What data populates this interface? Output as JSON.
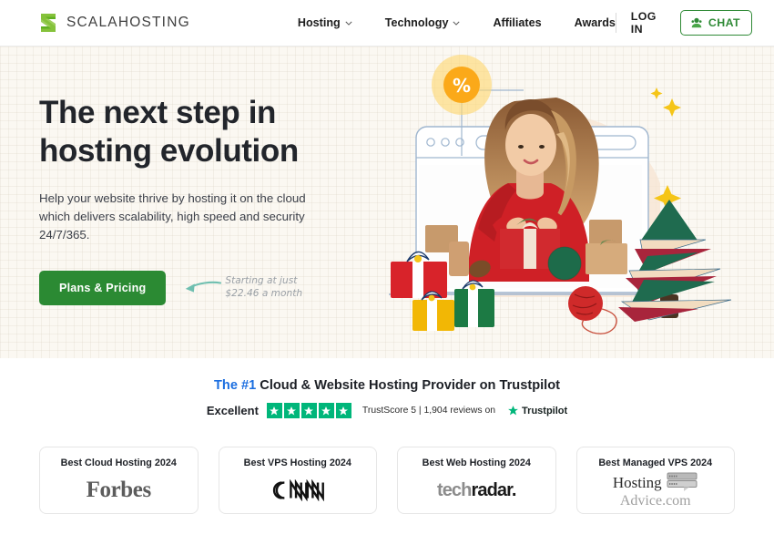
{
  "header": {
    "logo": {
      "icon": "scalahosting-s-logo-icon",
      "text": "SCALAHOSTING"
    },
    "nav": [
      {
        "label": "Hosting",
        "has_dropdown": true,
        "icon": "chevron-down-icon"
      },
      {
        "label": "Technology",
        "has_dropdown": true,
        "icon": "chevron-down-icon"
      },
      {
        "label": "Affiliates",
        "has_dropdown": false
      },
      {
        "label": "Awards",
        "has_dropdown": false
      }
    ],
    "login_label": "LOG IN",
    "chat_label": "CHAT",
    "chat_icon": "support-agent-icon"
  },
  "hero": {
    "heading": "The next step in hosting evolution",
    "subheading": "Help your website thrive by hosting it on the cloud which delivers scalability, high speed and security 24/7/365.",
    "cta_label": "Plans & Pricing",
    "note": "Starting at just\n$22.46 a month",
    "arrow_icon": "curved-left-arrow-icon",
    "illustration": {
      "name": "christmas-gift-wrapping-illustration",
      "badge_glyph": "%",
      "elements": [
        "browser-window-frame",
        "discount-percent-badge",
        "woman-wrapping-gift-photo",
        "christmas-tree",
        "gift-boxes",
        "yarn-balls",
        "sparkle-stars"
      ]
    },
    "colors": {
      "background": "#FBF8F2",
      "cta_green": "#2B8A33",
      "badge_orange": "#FBA919",
      "tree_green": "#1F6B4F",
      "tree_red": "#A8253C",
      "tree_cream": "#F2DCC0"
    }
  },
  "trust": {
    "headline_highlight": "The #1",
    "headline_rest": " Cloud & Website Hosting Provider on Trustpilot",
    "rating_label": "Excellent",
    "stars": 5,
    "score_text": "TrustScore 5 | 1,904 reviews on",
    "brand_name": "Trustpilot",
    "brand_icon": "trustpilot-star-icon",
    "star_color": "#00B67A",
    "highlight_color": "#1B6EE0"
  },
  "awards": [
    {
      "title": "Best Cloud Hosting 2024",
      "logo": "Forbes",
      "logo_icon": "forbes-logo"
    },
    {
      "title": "Best VPS Hosting 2024",
      "logo": "CNN",
      "logo_icon": "cnn-logo"
    },
    {
      "title": "Best Web Hosting 2024",
      "logo_part1": "tech",
      "logo_part2": "radar.",
      "logo_icon": "techradar-logo"
    },
    {
      "title": "Best Managed VPS 2024",
      "logo_part1": "Hosting",
      "logo_part2": "Advice.com",
      "logo_icon": "hostingadvice-logo"
    }
  ]
}
